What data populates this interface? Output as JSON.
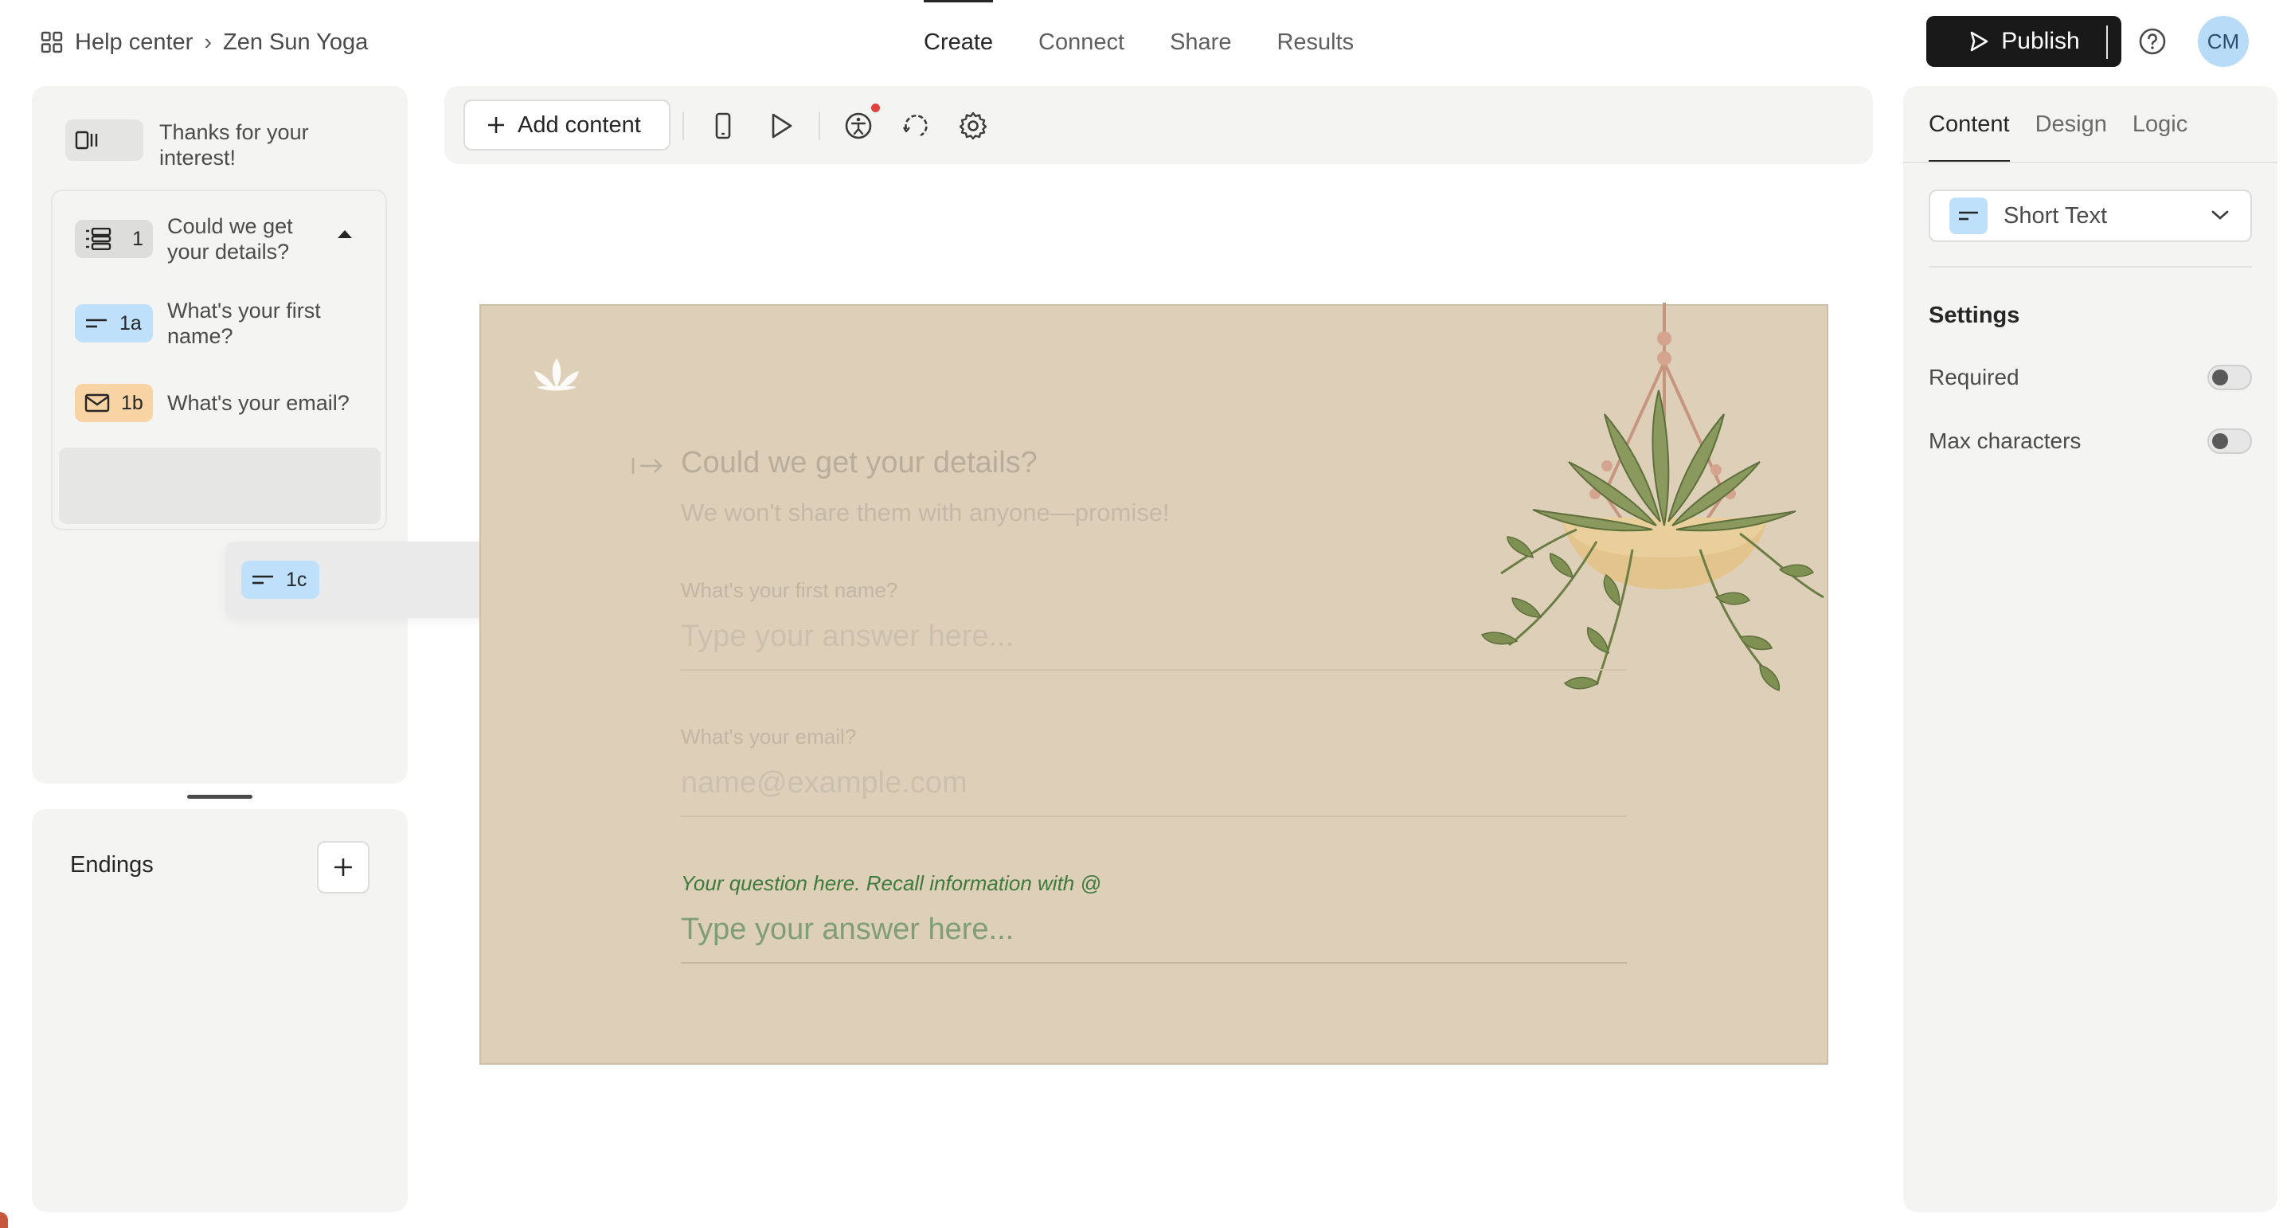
{
  "breadcrumb": {
    "parent": "Help center",
    "separator": "›",
    "current": "Zen Sun Yoga",
    "icon": "grid-icon"
  },
  "nav": {
    "tabs": [
      "Create",
      "Connect",
      "Share",
      "Results"
    ],
    "active": "Create"
  },
  "header": {
    "publish_label": "Publish",
    "help_icon": "help-circle-icon",
    "avatar_initials": "CM"
  },
  "sidebar": {
    "welcome": {
      "label": "Thanks for your interest!"
    },
    "group": {
      "number": "1",
      "label": "Could we get your details?",
      "expanded": true
    },
    "questions": [
      {
        "number": "1a",
        "label": "What's your first name?",
        "type": "short-text"
      },
      {
        "number": "1b",
        "label": "What's your email?",
        "type": "email"
      }
    ],
    "dragged": {
      "number": "1c",
      "type": "short-text"
    },
    "endings": {
      "title": "Endings"
    }
  },
  "toolbar": {
    "add_content_label": "Add content",
    "icons": [
      "mobile-preview-icon",
      "play-icon",
      "accessibility-icon",
      "loop-icon",
      "settings-gear-icon"
    ]
  },
  "form_preview": {
    "title": "Could we get your details?",
    "subtitle": "We won't share them with anyone—promise!",
    "fields": [
      {
        "label": "What's your first name?",
        "placeholder": "Type your answer here..."
      },
      {
        "label": "What's your email?",
        "placeholder": "name@example.com"
      }
    ],
    "new_question": {
      "label": "Your question here. Recall information with @",
      "placeholder": "Type your answer here..."
    }
  },
  "right_panel": {
    "tabs": [
      "Content",
      "Design",
      "Logic"
    ],
    "active_tab": "Content",
    "question_type": "Short Text",
    "settings_title": "Settings",
    "settings": [
      {
        "label": "Required",
        "enabled": false
      },
      {
        "label": "Max characters",
        "enabled": false
      }
    ]
  },
  "colors": {
    "canvas_bg": "#ded0b8",
    "accent_dark": "#191919",
    "badge_blue": "#bfe0fb",
    "badge_orange": "#f8d3a3",
    "question_label_green": "#3e7a3d",
    "avatar_bg": "#b8dcf7"
  }
}
